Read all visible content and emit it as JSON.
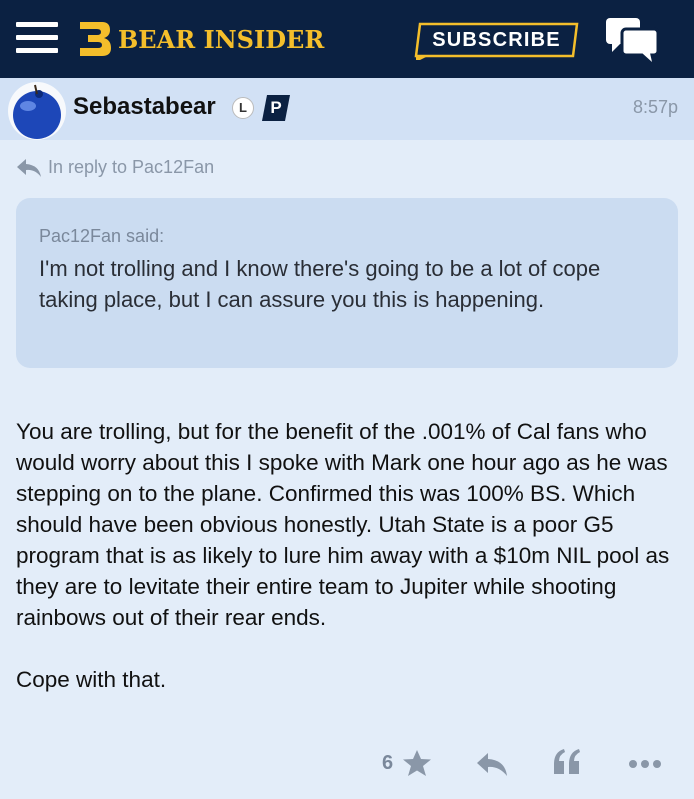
{
  "header": {
    "brand": "BEAR INSIDER",
    "subscribe_label": "SUBSCRIBE",
    "colors": {
      "nav_bg": "#0b2142",
      "brand_gold": "#f4be2b"
    },
    "icons": {
      "menu": "hamburger-menu-icon",
      "logo": "bear-logo-icon",
      "chat": "chat-bubbles-icon"
    }
  },
  "post": {
    "author": "Sebastabear",
    "badge_l": "L",
    "badge_p": "P",
    "time": "8:57p",
    "reply_to": "In reply to Pac12Fan",
    "quote": {
      "author": "Pac12Fan said:",
      "text": "I'm not trolling and I know there's going to be a lot of cope taking place, but I can assure you this is happening."
    },
    "body": [
      "You are trolling, but for the benefit of the .001% of Cal fans who would worry about this I spoke with Mark one hour ago as he was stepping on to the plane. Confirmed this was 100% BS. Which should have been obvious honestly. Utah State is a poor G5 program that is as likely to lure him away with a $10m NIL pool as they are to levitate their entire team to Jupiter while shooting rainbows out of their rear ends.",
      "Cope with that."
    ],
    "likes": "6"
  },
  "footer": {
    "icons": {
      "like": "star-icon",
      "reply": "reply-arrow-icon",
      "quote": "quote-icon",
      "more": "more-dots-icon"
    }
  }
}
